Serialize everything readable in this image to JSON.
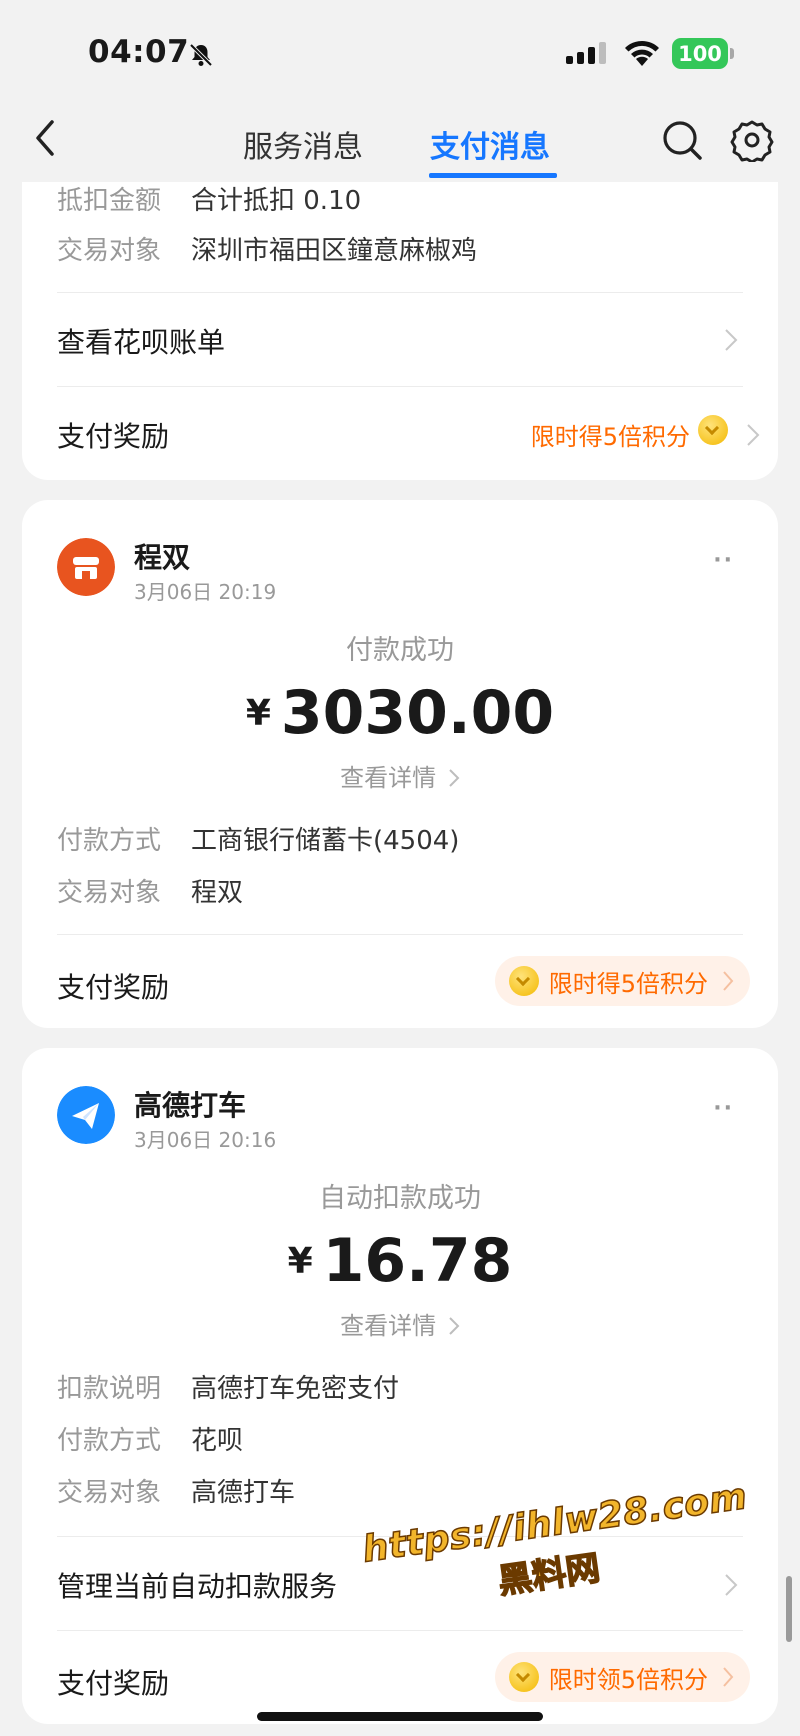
{
  "status_bar": {
    "time": "04:07",
    "battery": "100"
  },
  "nav": {
    "tabs": [
      "服务消息",
      "支付消息"
    ],
    "active_tab": "支付消息"
  },
  "card1": {
    "rows": [
      {
        "key": "抵扣金额",
        "value": "合计抵扣 0.10"
      },
      {
        "key": "交易对象",
        "value": "深圳市福田区鐘意麻椒鸡"
      }
    ],
    "huabei_bill": "查看花呗账单",
    "reward_label": "支付奖励",
    "reward_text": "限时得5倍积分"
  },
  "card2": {
    "merchant": "程双",
    "time": "3月06日 20:19",
    "more": "··",
    "status": "付款成功",
    "currency": "¥",
    "amount": "3030.00",
    "detail_link": "查看详情",
    "rows": [
      {
        "key": "付款方式",
        "value": "工商银行储蓄卡(4504)"
      },
      {
        "key": "交易对象",
        "value": "程双"
      }
    ],
    "reward_label": "支付奖励",
    "reward_text": "限时得5倍积分"
  },
  "card3": {
    "merchant": "高德打车",
    "time": "3月06日 20:16",
    "more": "··",
    "status": "自动扣款成功",
    "currency": "¥",
    "amount": "16.78",
    "detail_link": "查看详情",
    "rows": [
      {
        "key": "扣款说明",
        "value": "高德打车免密支付"
      },
      {
        "key": "付款方式",
        "value": "花呗"
      },
      {
        "key": "交易对象",
        "value": "高德打车"
      }
    ],
    "manage_label": "管理当前自动扣款服务",
    "reward_label": "支付奖励",
    "reward_text": "限时领5倍积分"
  },
  "watermark": {
    "url": "https://ihlw28.com",
    "name": "黑料网"
  },
  "colors": {
    "accent": "#1677ff",
    "reward": "#ff6a00",
    "merchant1": "#e8541f",
    "merchant2": "#1a8cff"
  }
}
